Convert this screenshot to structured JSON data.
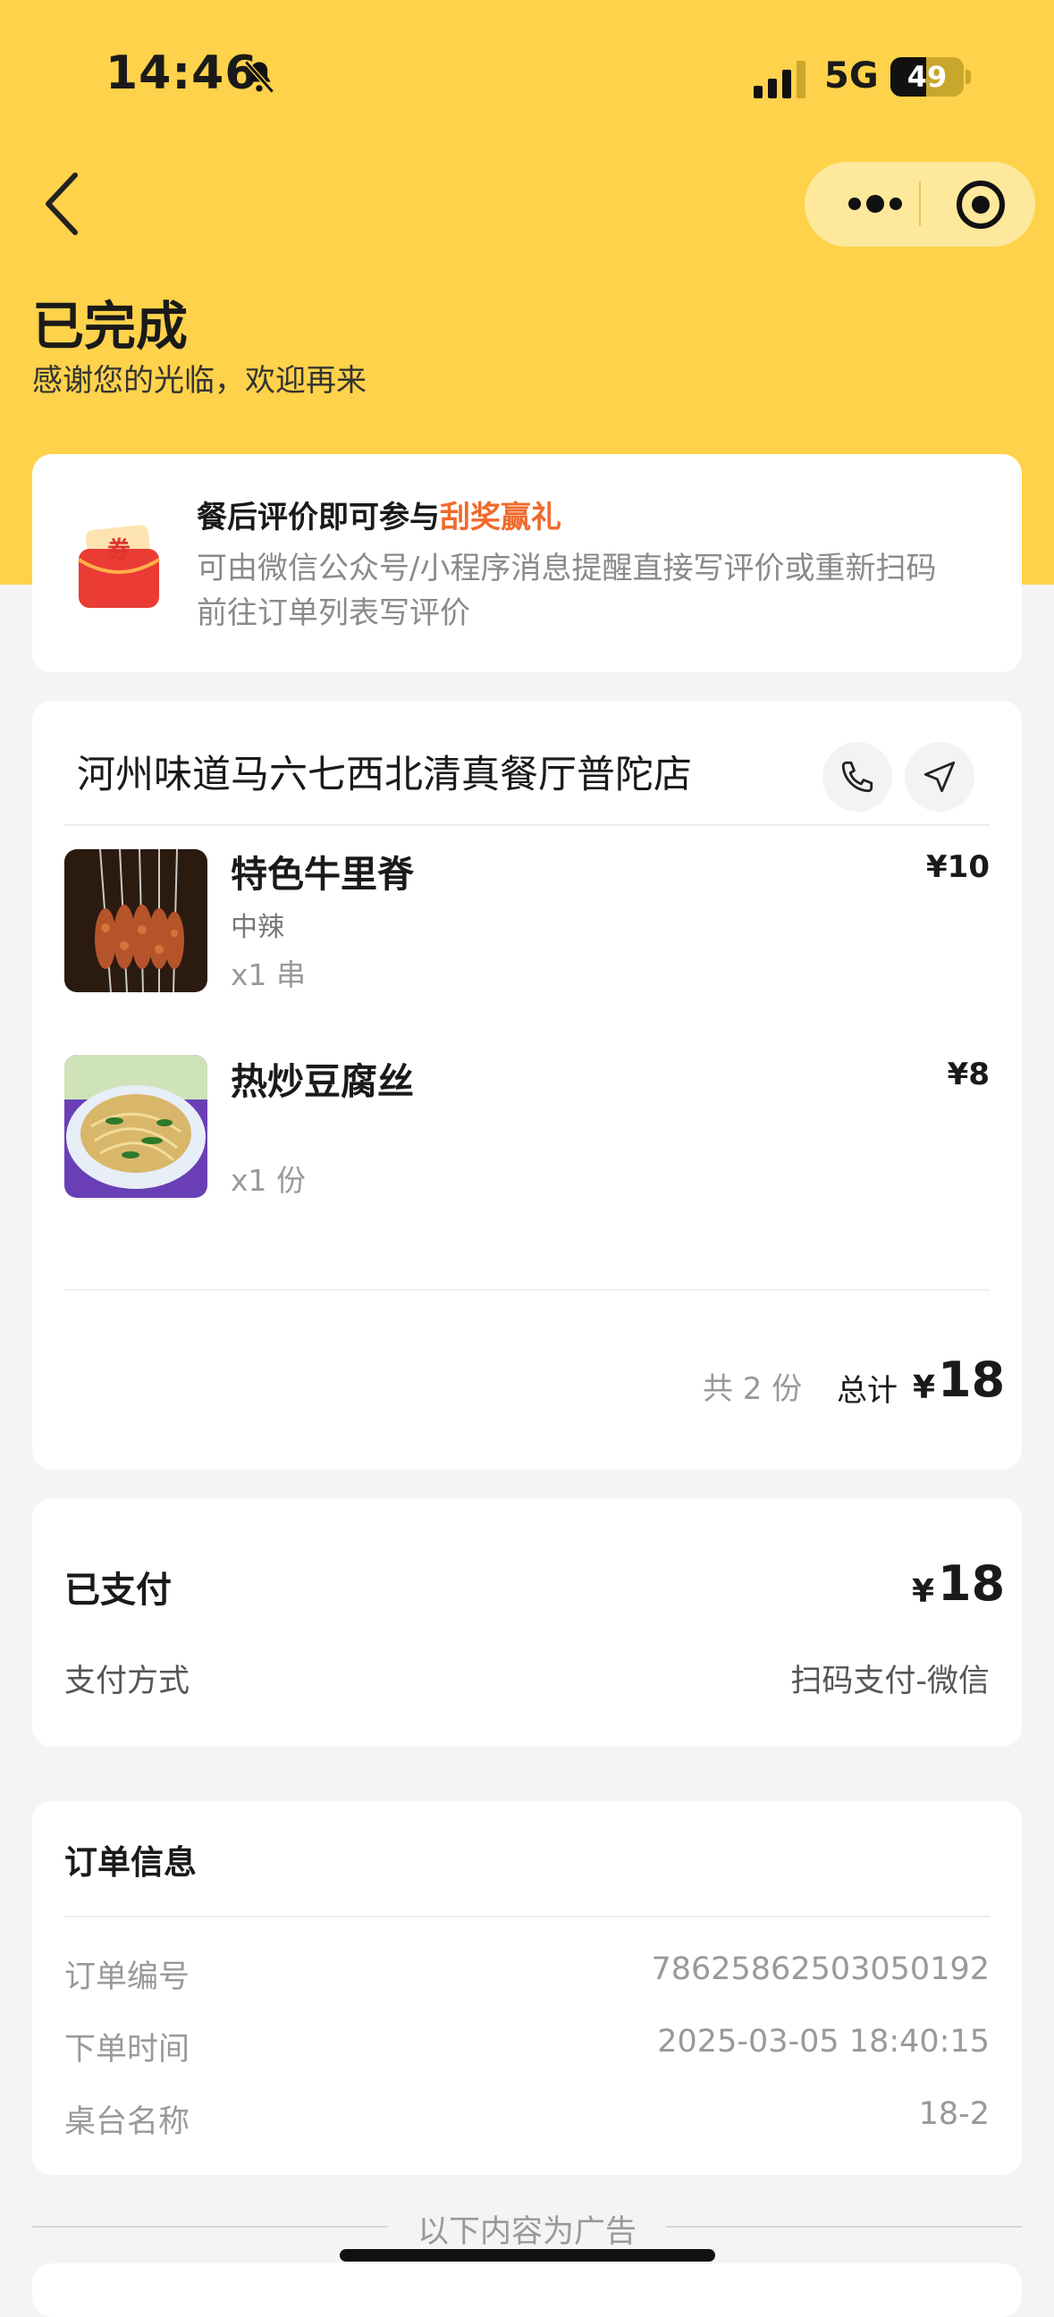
{
  "status_bar": {
    "time": "14:46",
    "network": "5G",
    "battery": "49",
    "battery_level": 0.49
  },
  "header": {
    "title": "已完成",
    "subtitle": "感谢您的光临，欢迎再来"
  },
  "promo": {
    "title_main": "餐后评价即可参与",
    "title_highlight": "刮奖赢礼",
    "coupon_glyph": "券",
    "desc_line1": "可由微信公众号/小程序消息提醒直接写评价或重新扫码",
    "desc_line2": "前往订单列表写评价",
    "accent_color": "#f06a2c"
  },
  "shop": {
    "name": "河州味道马六七西北清真餐厅普陀店"
  },
  "items": [
    {
      "name": "特色牛里脊",
      "spec": "中辣",
      "qty": "x1 串",
      "price": "¥10"
    },
    {
      "name": "热炒豆腐丝",
      "spec": "",
      "qty": "x1 份",
      "price": "¥8"
    }
  ],
  "summary": {
    "count": "共 2 份",
    "total_label": "总计",
    "currency": "¥",
    "total": "18"
  },
  "payment": {
    "label": "已支付",
    "currency": "¥",
    "amount": "18",
    "method_label": "支付方式",
    "method_value": "扫码支付-微信"
  },
  "order_info": {
    "title": "订单信息",
    "rows": [
      {
        "label": "订单编号",
        "value": "78625862503050192"
      },
      {
        "label": "下单时间",
        "value": "2025-03-05 18:40:15"
      },
      {
        "label": "桌台名称",
        "value": "18-2"
      }
    ]
  },
  "ad_divider": "以下内容为广告",
  "colors": {
    "header_bg": "#fed24a",
    "page_bg": "#f4f4f4"
  }
}
